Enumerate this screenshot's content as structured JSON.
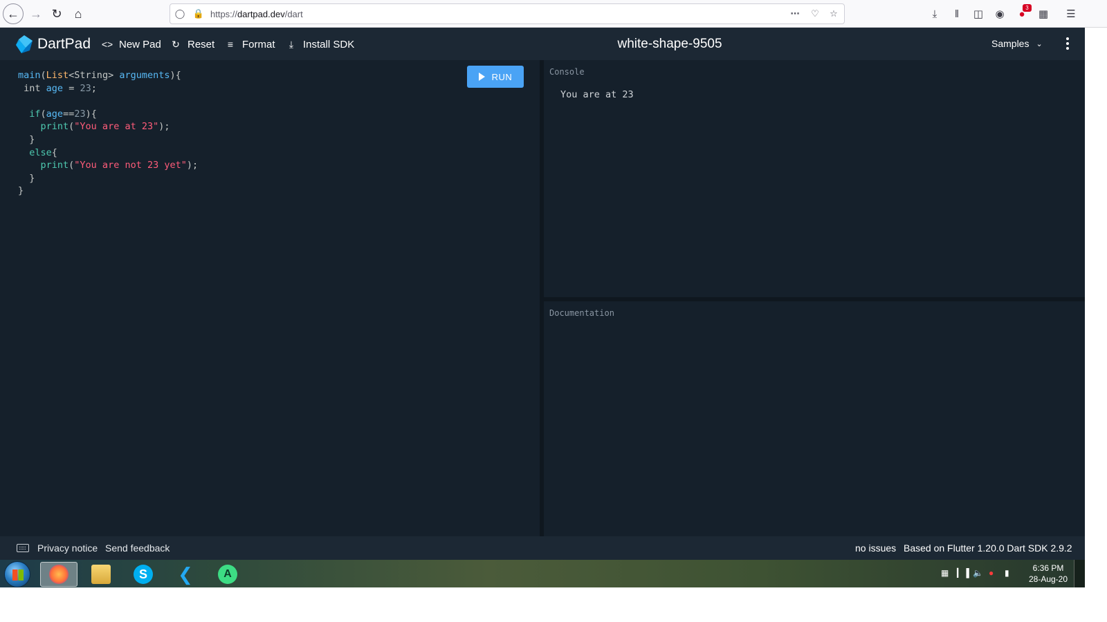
{
  "browser": {
    "url_prefix": "https://",
    "url_host": "dartpad.dev",
    "url_path": "/dart",
    "notification_count": "3"
  },
  "header": {
    "logo_text": "DartPad",
    "new_pad": "New Pad",
    "reset": "Reset",
    "format": "Format",
    "install_sdk": "Install SDK",
    "pad_title": "white-shape-9505",
    "samples": "Samples"
  },
  "editor": {
    "run_label": "RUN",
    "code_lines": [
      "main(List<String> arguments){",
      " int age = 23;",
      "",
      "  if(age==23){",
      "    print(\"You are at 23\");",
      "  }",
      "  else{",
      "    print(\"You are not 23 yet\");",
      "  }",
      "}"
    ]
  },
  "console": {
    "label": "Console",
    "output": "You are at 23"
  },
  "docs": {
    "label": "Documentation"
  },
  "footer": {
    "privacy": "Privacy notice",
    "feedback": "Send feedback",
    "issues": "no issues",
    "sdk_info": "Based on Flutter 1.20.0 Dart SDK 2.9.2"
  },
  "taskbar": {
    "time": "6:36 PM",
    "date": "28-Aug-20",
    "apps": [
      "firefox-icon",
      "file-explorer-icon",
      "skype-icon",
      "vscode-icon",
      "android-studio-icon"
    ]
  },
  "colors": {
    "header_bg": "#1c2834",
    "editor_bg": "#15202b",
    "run_button": "#4aa3f5"
  }
}
